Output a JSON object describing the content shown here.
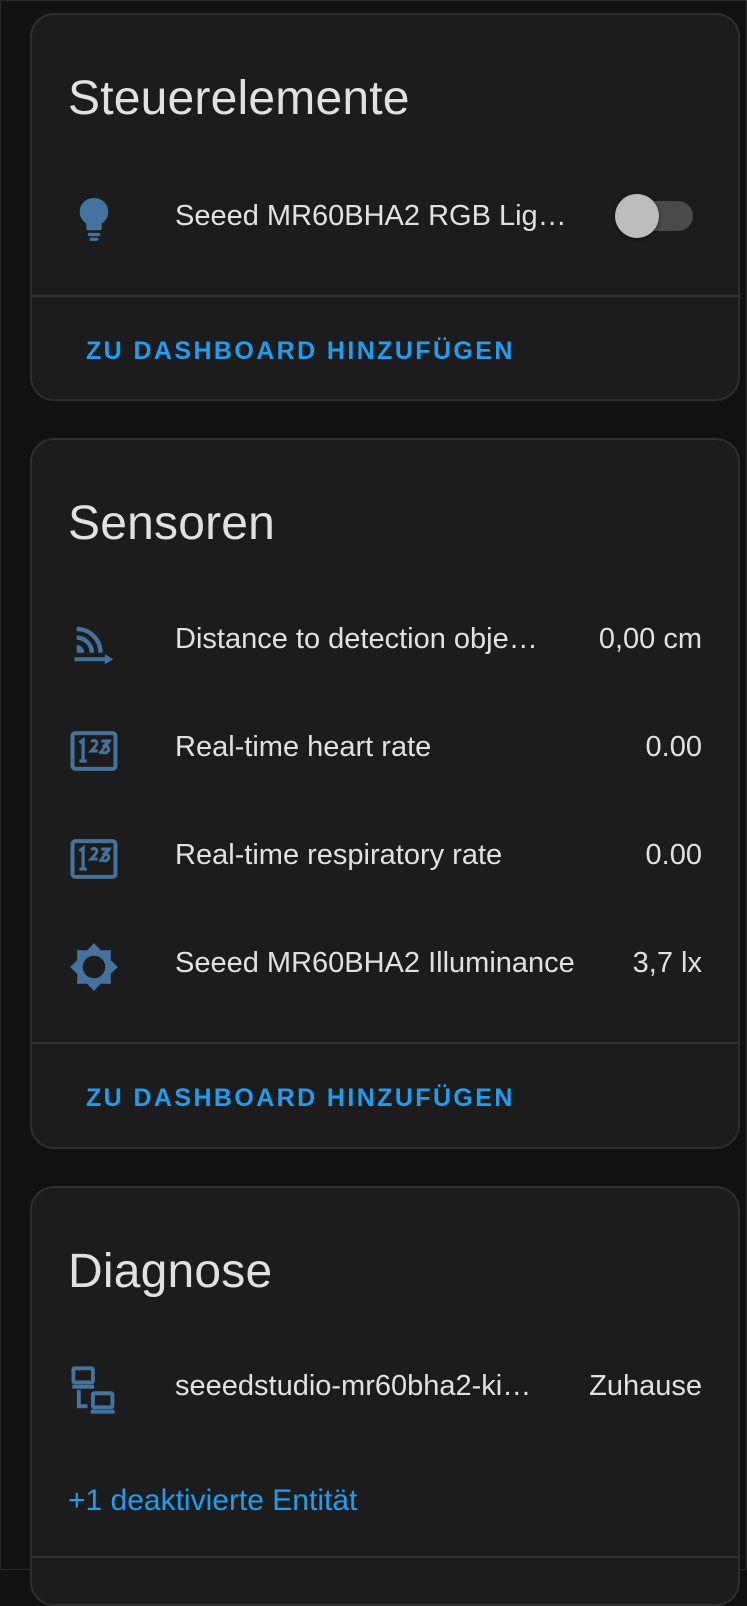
{
  "colors": {
    "background": "#111111",
    "card": "#1c1c1c",
    "text": "#e1e1e1",
    "icon": "#44739e",
    "link": "#1e9ef0"
  },
  "controls": {
    "title": "Steuerelemente",
    "items": [
      {
        "icon": "lightbulb-icon",
        "label": "Seeed MR60BHA2 RGB Lig…",
        "state": "off"
      }
    ],
    "add_to_dashboard": "ZU DASHBOARD HINZUFÜGEN"
  },
  "sensors": {
    "title": "Sensoren",
    "items": [
      {
        "icon": "signal-distance-icon",
        "label": "Distance to detection obje…",
        "value": "0,00 cm"
      },
      {
        "icon": "numeric-icon",
        "label": "Real-time heart rate",
        "value": "0.00"
      },
      {
        "icon": "numeric-icon",
        "label": "Real-time respiratory rate",
        "value": "0.00"
      },
      {
        "icon": "brightness-icon",
        "label": "Seeed MR60BHA2 Illuminance",
        "value": "3,7 lx"
      }
    ],
    "add_to_dashboard": "ZU DASHBOARD HINZUFÜGEN"
  },
  "diagnostics": {
    "title": "Diagnose",
    "items": [
      {
        "icon": "network-icon",
        "label": "seeedstudio-mr60bha2-ki…",
        "value": "Zuhause"
      }
    ],
    "disabled_entities": "+1 deaktivierte Entität"
  }
}
